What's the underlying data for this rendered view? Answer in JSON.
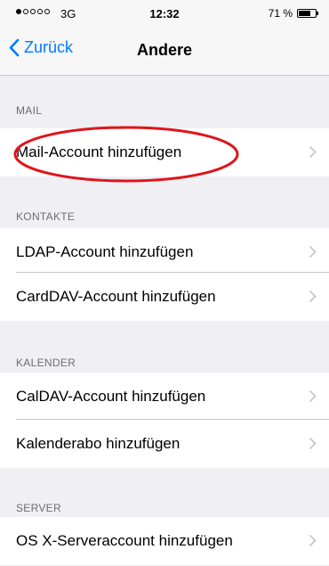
{
  "status_bar": {
    "signal_filled": 1,
    "signal_total": 5,
    "network": "3G",
    "time": "12:32",
    "battery_percent": "71 %",
    "battery_level": 0.71
  },
  "nav": {
    "back_label": "Zurück",
    "title": "Andere"
  },
  "sections": [
    {
      "header": "MAIL",
      "items": [
        {
          "label": "Mail-Account hinzufügen"
        }
      ]
    },
    {
      "header": "KONTAKTE",
      "items": [
        {
          "label": "LDAP-Account hinzufügen"
        },
        {
          "label": "CardDAV-Account hinzufügen"
        }
      ]
    },
    {
      "header": "KALENDER",
      "items": [
        {
          "label": "CalDAV-Account hinzufügen"
        },
        {
          "label": "Kalenderabo hinzufügen"
        }
      ]
    },
    {
      "header": "SERVER",
      "items": [
        {
          "label": "OS X-Serveraccount hinzufügen"
        }
      ]
    }
  ],
  "annotation": {
    "highlight_color": "#e0141a",
    "icon": "red-ellipse-highlight"
  },
  "colors": {
    "accent": "#007aff",
    "background": "#efeff4"
  }
}
